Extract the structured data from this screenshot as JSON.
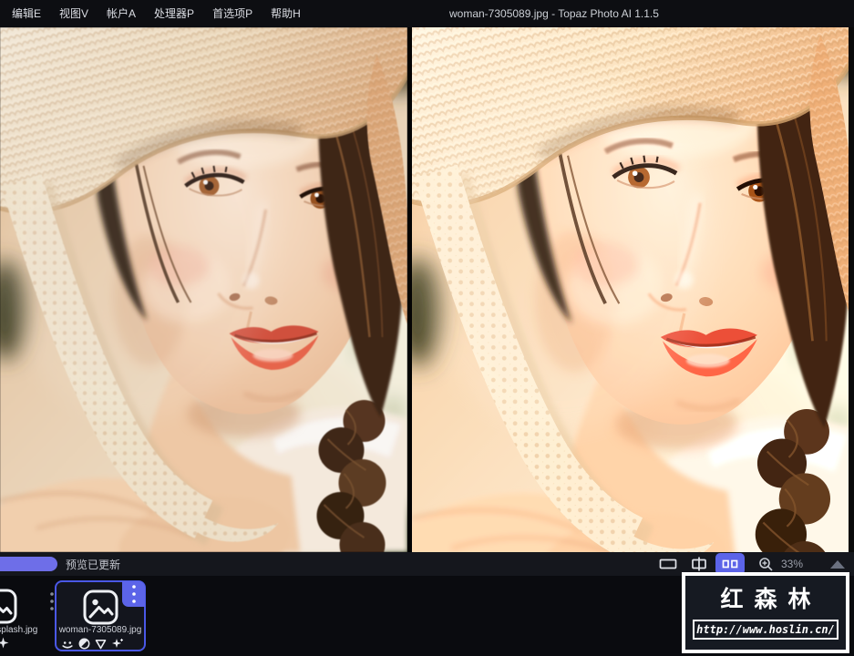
{
  "window": {
    "title": "woman-7305089.jpg - Topaz Photo AI 1.1.5"
  },
  "menu": {
    "items": [
      {
        "label": "编辑E"
      },
      {
        "label": "视图V"
      },
      {
        "label": "帐户A"
      },
      {
        "label": "处理器P"
      },
      {
        "label": "首选项P"
      },
      {
        "label": "帮助H"
      }
    ]
  },
  "viewer": {
    "layout": "side-by-side",
    "image_description": "close-up portrait of a young woman in a crochet straw hat with lace ribbon, dark braided hair, coral lips; left pane original, right pane AI-enhanced"
  },
  "statusbar": {
    "progress_text": "预览已更新",
    "zoom_value": "33%",
    "view_modes": [
      {
        "name": "single",
        "selected": false
      },
      {
        "name": "split",
        "selected": false
      },
      {
        "name": "side-by-side",
        "selected": true
      }
    ]
  },
  "filmstrip": {
    "files": [
      {
        "name": "nsplash.jpg",
        "selected": false,
        "enhancements": [
          "enhance"
        ]
      },
      {
        "name": "woman-7305089.jpg",
        "selected": true,
        "enhancements": [
          "face-recovery",
          "remove-noise",
          "sharpen",
          "enhance"
        ]
      }
    ]
  },
  "watermark": {
    "title": "红森林",
    "url": "http://www.hoslin.cn/"
  },
  "colors": {
    "accent": "#5c64e8",
    "progress_pill": "#6e6ee8",
    "selected_thumb_border": "#4a58e6",
    "titlebar_bg": "#0d0e12",
    "statusbar_bg": "#15171d",
    "filmstrip_bg": "#0a0b0f"
  }
}
